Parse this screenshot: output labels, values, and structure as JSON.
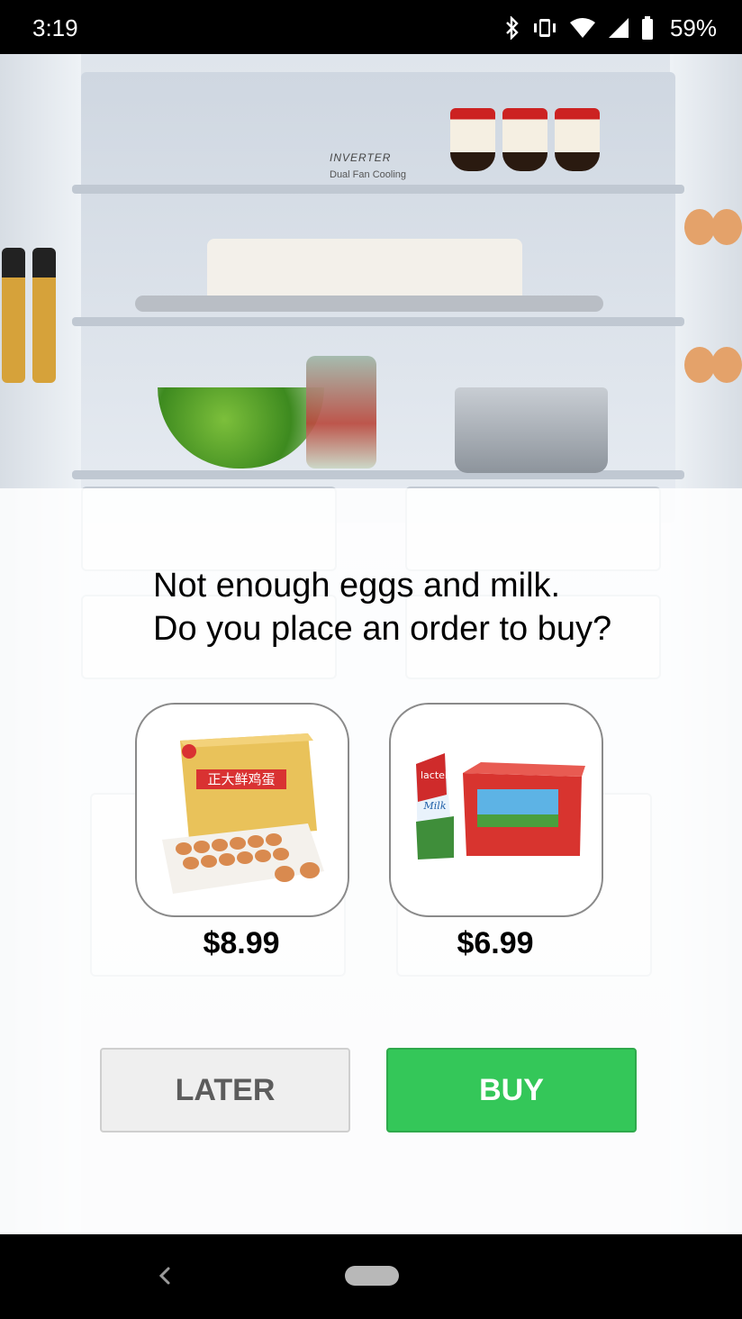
{
  "status_bar": {
    "time": "3:19",
    "battery_percent": "59%",
    "icons": [
      "bluetooth-icon",
      "vibrate-icon",
      "wifi-icon",
      "signal-icon",
      "battery-icon"
    ]
  },
  "background": {
    "brand_text": "INVERTER",
    "brand_sub": "Dual Fan Cooling"
  },
  "dialog": {
    "line1": "Not enough eggs and milk.",
    "line2": "Do you place an order to buy?"
  },
  "products": [
    {
      "name": "eggs",
      "price": "$8.99",
      "box_text": "正大鲜鸡蛋"
    },
    {
      "name": "milk",
      "price": "$6.99",
      "box_text": "lactel",
      "box_sub": "Milk"
    }
  ],
  "buttons": {
    "later": "LATER",
    "buy": "BUY"
  },
  "colors": {
    "buy_green": "#34c759",
    "later_gray": "#efefef"
  },
  "nav_bar": {
    "icons": [
      "back-icon",
      "home-pill-icon"
    ]
  }
}
